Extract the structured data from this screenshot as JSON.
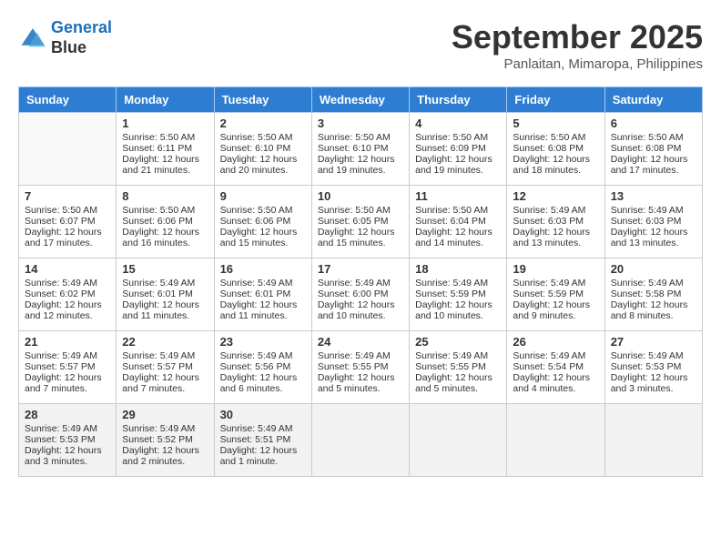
{
  "header": {
    "logo_line1": "General",
    "logo_line2": "Blue",
    "month": "September 2025",
    "location": "Panlaitan, Mimaropa, Philippines"
  },
  "weekdays": [
    "Sunday",
    "Monday",
    "Tuesday",
    "Wednesday",
    "Thursday",
    "Friday",
    "Saturday"
  ],
  "weeks": [
    [
      {
        "day": "",
        "info": ""
      },
      {
        "day": "1",
        "info": "Sunrise: 5:50 AM\nSunset: 6:11 PM\nDaylight: 12 hours\nand 21 minutes."
      },
      {
        "day": "2",
        "info": "Sunrise: 5:50 AM\nSunset: 6:10 PM\nDaylight: 12 hours\nand 20 minutes."
      },
      {
        "day": "3",
        "info": "Sunrise: 5:50 AM\nSunset: 6:10 PM\nDaylight: 12 hours\nand 19 minutes."
      },
      {
        "day": "4",
        "info": "Sunrise: 5:50 AM\nSunset: 6:09 PM\nDaylight: 12 hours\nand 19 minutes."
      },
      {
        "day": "5",
        "info": "Sunrise: 5:50 AM\nSunset: 6:08 PM\nDaylight: 12 hours\nand 18 minutes."
      },
      {
        "day": "6",
        "info": "Sunrise: 5:50 AM\nSunset: 6:08 PM\nDaylight: 12 hours\nand 17 minutes."
      }
    ],
    [
      {
        "day": "7",
        "info": "Sunrise: 5:50 AM\nSunset: 6:07 PM\nDaylight: 12 hours\nand 17 minutes."
      },
      {
        "day": "8",
        "info": "Sunrise: 5:50 AM\nSunset: 6:06 PM\nDaylight: 12 hours\nand 16 minutes."
      },
      {
        "day": "9",
        "info": "Sunrise: 5:50 AM\nSunset: 6:06 PM\nDaylight: 12 hours\nand 15 minutes."
      },
      {
        "day": "10",
        "info": "Sunrise: 5:50 AM\nSunset: 6:05 PM\nDaylight: 12 hours\nand 15 minutes."
      },
      {
        "day": "11",
        "info": "Sunrise: 5:50 AM\nSunset: 6:04 PM\nDaylight: 12 hours\nand 14 minutes."
      },
      {
        "day": "12",
        "info": "Sunrise: 5:49 AM\nSunset: 6:03 PM\nDaylight: 12 hours\nand 13 minutes."
      },
      {
        "day": "13",
        "info": "Sunrise: 5:49 AM\nSunset: 6:03 PM\nDaylight: 12 hours\nand 13 minutes."
      }
    ],
    [
      {
        "day": "14",
        "info": "Sunrise: 5:49 AM\nSunset: 6:02 PM\nDaylight: 12 hours\nand 12 minutes."
      },
      {
        "day": "15",
        "info": "Sunrise: 5:49 AM\nSunset: 6:01 PM\nDaylight: 12 hours\nand 11 minutes."
      },
      {
        "day": "16",
        "info": "Sunrise: 5:49 AM\nSunset: 6:01 PM\nDaylight: 12 hours\nand 11 minutes."
      },
      {
        "day": "17",
        "info": "Sunrise: 5:49 AM\nSunset: 6:00 PM\nDaylight: 12 hours\nand 10 minutes."
      },
      {
        "day": "18",
        "info": "Sunrise: 5:49 AM\nSunset: 5:59 PM\nDaylight: 12 hours\nand 10 minutes."
      },
      {
        "day": "19",
        "info": "Sunrise: 5:49 AM\nSunset: 5:59 PM\nDaylight: 12 hours\nand 9 minutes."
      },
      {
        "day": "20",
        "info": "Sunrise: 5:49 AM\nSunset: 5:58 PM\nDaylight: 12 hours\nand 8 minutes."
      }
    ],
    [
      {
        "day": "21",
        "info": "Sunrise: 5:49 AM\nSunset: 5:57 PM\nDaylight: 12 hours\nand 7 minutes."
      },
      {
        "day": "22",
        "info": "Sunrise: 5:49 AM\nSunset: 5:57 PM\nDaylight: 12 hours\nand 7 minutes."
      },
      {
        "day": "23",
        "info": "Sunrise: 5:49 AM\nSunset: 5:56 PM\nDaylight: 12 hours\nand 6 minutes."
      },
      {
        "day": "24",
        "info": "Sunrise: 5:49 AM\nSunset: 5:55 PM\nDaylight: 12 hours\nand 5 minutes."
      },
      {
        "day": "25",
        "info": "Sunrise: 5:49 AM\nSunset: 5:55 PM\nDaylight: 12 hours\nand 5 minutes."
      },
      {
        "day": "26",
        "info": "Sunrise: 5:49 AM\nSunset: 5:54 PM\nDaylight: 12 hours\nand 4 minutes."
      },
      {
        "day": "27",
        "info": "Sunrise: 5:49 AM\nSunset: 5:53 PM\nDaylight: 12 hours\nand 3 minutes."
      }
    ],
    [
      {
        "day": "28",
        "info": "Sunrise: 5:49 AM\nSunset: 5:53 PM\nDaylight: 12 hours\nand 3 minutes."
      },
      {
        "day": "29",
        "info": "Sunrise: 5:49 AM\nSunset: 5:52 PM\nDaylight: 12 hours\nand 2 minutes."
      },
      {
        "day": "30",
        "info": "Sunrise: 5:49 AM\nSunset: 5:51 PM\nDaylight: 12 hours\nand 1 minute."
      },
      {
        "day": "",
        "info": ""
      },
      {
        "day": "",
        "info": ""
      },
      {
        "day": "",
        "info": ""
      },
      {
        "day": "",
        "info": ""
      }
    ]
  ]
}
